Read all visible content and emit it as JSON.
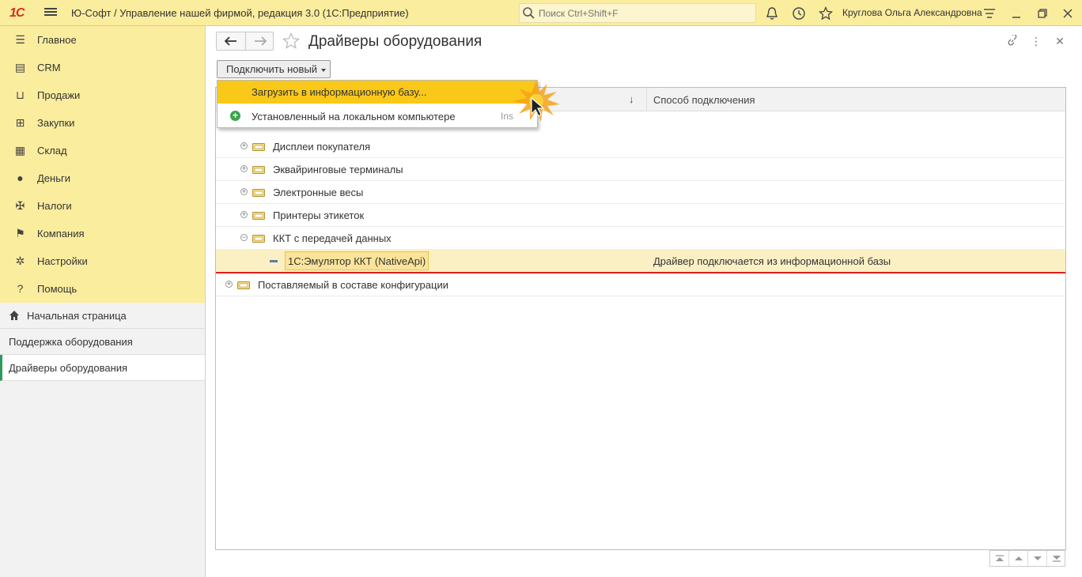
{
  "titlebar": {
    "logo": "1С",
    "app_title": "Ю-Софт / Управление нашей фирмой, редакция 3.0  (1С:Предприятие)",
    "search_placeholder": "Поиск Ctrl+Shift+F",
    "user_name": "Круглова Ольга Александровна"
  },
  "sidebar": {
    "items": [
      {
        "label": "Главное",
        "icon": "menu-lines-icon"
      },
      {
        "label": "CRM",
        "icon": "crm-icon"
      },
      {
        "label": "Продажи",
        "icon": "basket-icon"
      },
      {
        "label": "Закупки",
        "icon": "cart-icon"
      },
      {
        "label": "Склад",
        "icon": "grid-icon"
      },
      {
        "label": "Деньги",
        "icon": "coin-icon"
      },
      {
        "label": "Налоги",
        "icon": "eagle-icon"
      },
      {
        "label": "Компания",
        "icon": "flag-icon"
      },
      {
        "label": "Настройки",
        "icon": "gear-icon"
      },
      {
        "label": "Помощь",
        "icon": "question-icon"
      }
    ]
  },
  "subnav": {
    "items": [
      {
        "label": "Начальная страница"
      },
      {
        "label": "Поддержка оборудования"
      },
      {
        "label": "Драйверы оборудования"
      }
    ]
  },
  "page": {
    "title": "Драйверы оборудования",
    "connect_button": "Подключить новый"
  },
  "table": {
    "sort_indicator": "↓",
    "column2": "Способ подключения",
    "rows": [
      {
        "name": "Дисплеи покупателя"
      },
      {
        "name": "Эквайринговые терминалы"
      },
      {
        "name": "Электронные весы"
      },
      {
        "name": "Принтеры этикеток"
      },
      {
        "name": "ККТ с передачей данных"
      },
      {
        "name": "1С:Эмулятор ККТ (NativeApi)",
        "connection": "Драйвер подключается из информационной базы"
      },
      {
        "name": "Поставляемый в составе конфигурации"
      }
    ]
  },
  "dropdown": {
    "item1": "Загрузить в информационную базу...",
    "item2": "Установленный на локальном компьютере",
    "item2_shortcut": "Ins"
  },
  "colors": {
    "panel_yellow": "#fbed9e",
    "highlight_yellow": "#f9c818",
    "selection_red": "#e21d1d",
    "active_green": "#2e9a5a"
  }
}
